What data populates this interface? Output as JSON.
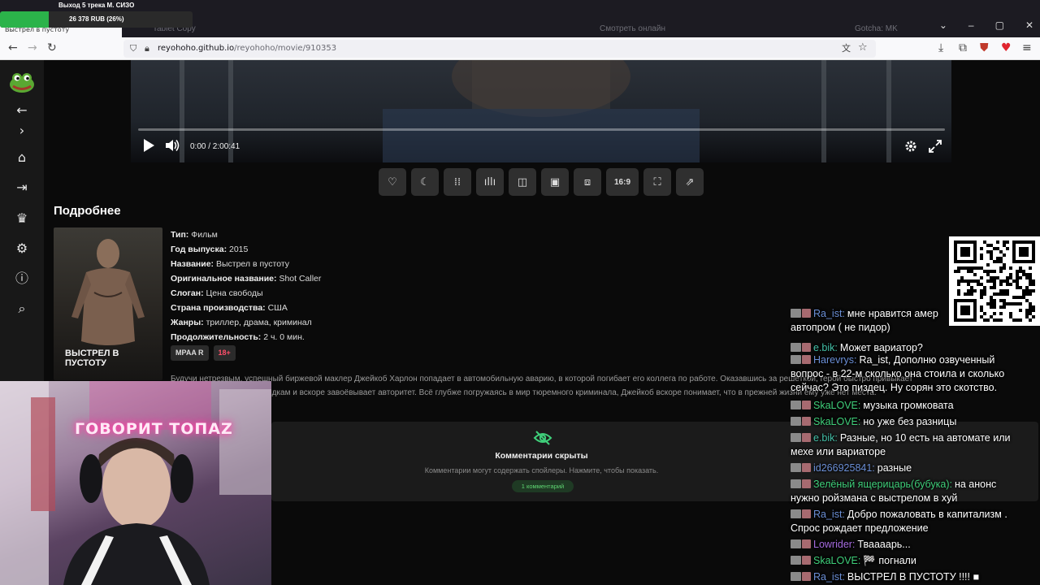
{
  "browser": {
    "tab_title": "Выстрел в пустоту",
    "other_tabs": [
      "Tablet Copy",
      "Смотреть онлайн",
      "Gotcha: MK"
    ],
    "url_host": "reyohoho.github.io",
    "url_path": "/reyohoho/movie/910353"
  },
  "stream_overlay": {
    "donate_title": "Выход 5 трека М. СИЗО",
    "donate_amount": "26 378 RUB (26%)",
    "donate_progress": 0.26
  },
  "sidebar": {
    "items": [
      "frog-logo",
      "back",
      "forward",
      "home",
      "login",
      "trophy",
      "settings",
      "info",
      "search"
    ]
  },
  "player": {
    "time": "0:00 / 2:00:41",
    "progress": 0,
    "toolbar_ratio_label": "16:9"
  },
  "details": {
    "section_title": "Подробнее",
    "poster_title": "ВЫСТРЕЛ В ПУСТОТУ",
    "fields": [
      {
        "key": "Тип:",
        "value": "Фильм"
      },
      {
        "key": "Год выпуска:",
        "value": "2015"
      },
      {
        "key": "Название:",
        "value": "Выстрел в пустоту"
      },
      {
        "key": "Оригинальное название:",
        "value": "Shot Caller"
      },
      {
        "key": "Слоган:",
        "value": "Цена свободы"
      },
      {
        "key": "Страна производства:",
        "value": "США"
      },
      {
        "key": "Жанры:",
        "value": "триллер, драма, криминал"
      },
      {
        "key": "Продолжительность:",
        "value": "2 ч. 0 мин."
      }
    ],
    "badge_mpaa": "MPAA R",
    "badge_age": "18+",
    "description_line1": "Будучи нетрезвым, успешный биржевой маклер Джейкоб Харлон попадает в автомобильную аварию, в которой погибает его коллега по работе. Оказавшись за решёткой, герой быстро привыкает",
    "description_line2": "к суровым тюремным порядкам и вскоре завоёвывает авторитет. Всё глубже погружаясь в мир тюремного криминала, Джейкоб вскоре понимает, что в прежней жизни ему уже нет места."
  },
  "comments": {
    "title": "Комментарии скрыты",
    "subtitle": "Комментарии могут содержать спойлеры. Нажмите, чтобы показать.",
    "count_label": "1 комментарий"
  },
  "webcam": {
    "neon_text": "ГОВОРИТ ТОПАZ"
  },
  "chat": {
    "messages": [
      {
        "nick": "Ra_ist:",
        "color": "#6b8fd6",
        "text": "мне нравится амер",
        "text2": "автопром ( не пидор)"
      },
      {
        "nick": "e.bik:",
        "color": "#44c0a8",
        "text": "Может вариатор?"
      },
      {
        "nick": "Harevrys:",
        "color": "#6b8fd6",
        "text": "Ra_ist, Дополню озвученный",
        "text2": "вопрос - в 22-м сколько она стоила и сколько",
        "text3": "сейчас? Это пиздец. Ну сорян это скотство."
      },
      {
        "nick": "SkaLOVE:",
        "color": "#3fcf7a",
        "text": "музыка громковата"
      },
      {
        "nick": "SkaLOVE:",
        "color": "#3fcf7a",
        "text": "но уже без разницы"
      },
      {
        "nick": "e.bik:",
        "color": "#44c0a8",
        "text": "Разные, но 10 есть на автомате или",
        "text2": "мехе или вариаторе"
      },
      {
        "nick": "id266925841:",
        "color": "#6b8fd6",
        "text": "разные"
      },
      {
        "nick": "Зелёный ящерицарь(бубука):",
        "color": "#3fcf7a",
        "text": "на анонс",
        "text2": "нужно ройзмана с выстрелом в хуй"
      },
      {
        "nick": "Ra_ist:",
        "color": "#6b8fd6",
        "text": "Добро пожаловать в капитализм .",
        "text2": "Спрос рождает предложение"
      },
      {
        "nick": "Lowrider:",
        "color": "#a56be0",
        "text": "Тваааарь..."
      },
      {
        "nick": "SkaLOVE:",
        "color": "#3fcf7a",
        "text": "🏁 погнали"
      },
      {
        "nick": "Ra_ist:",
        "color": "#6b8fd6",
        "text": "ВЫСТРЕЛ В ПУСТОТУ !!!! ■"
      }
    ]
  }
}
